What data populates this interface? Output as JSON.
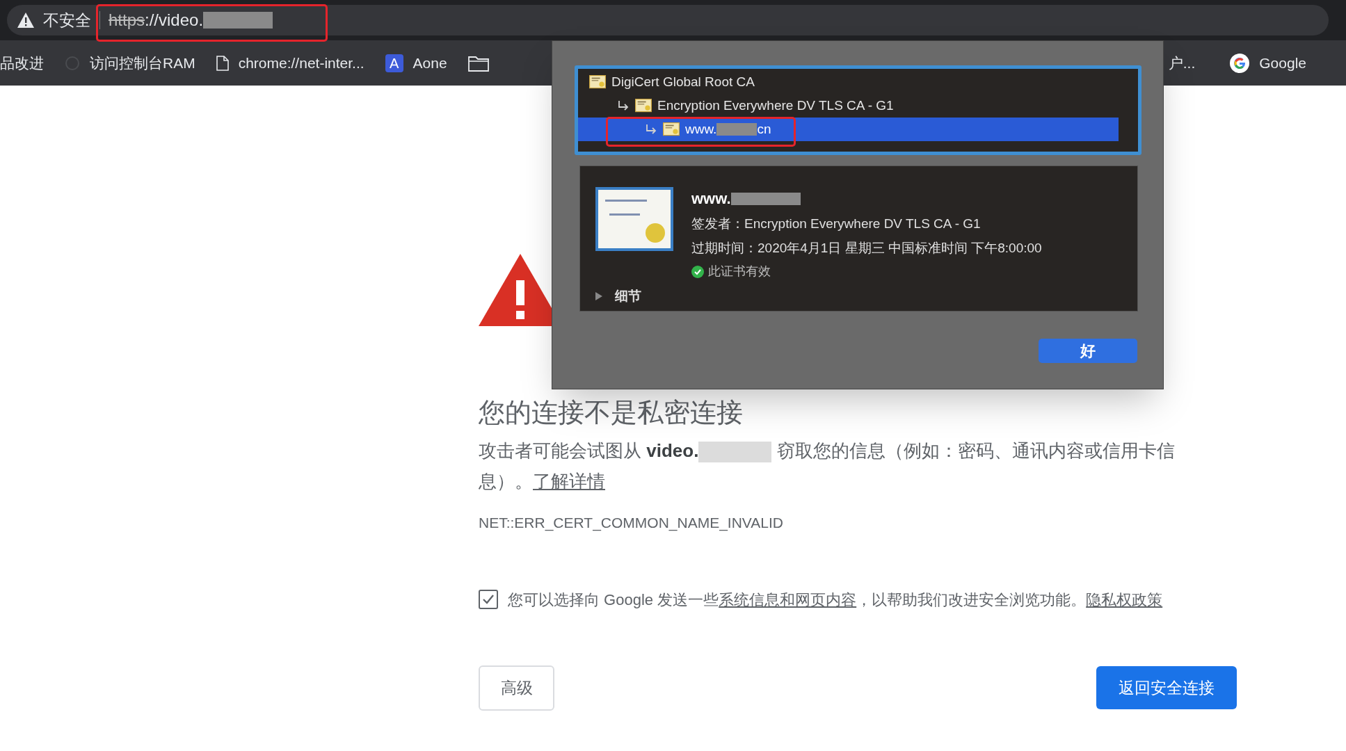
{
  "address_bar": {
    "security_label": "不安全",
    "url_scheme": "https",
    "url_rest": "://video."
  },
  "bookmarks": [
    {
      "kind": "text",
      "label": "品改进"
    },
    {
      "kind": "faint",
      "label": "访问控制台RAM"
    },
    {
      "kind": "page",
      "label": "chrome://net-inter..."
    },
    {
      "kind": "letter",
      "icon_letter": "A",
      "label": "Aone"
    },
    {
      "kind": "folder"
    }
  ],
  "bookmarks_right": [
    {
      "kind": "text",
      "label": "户..."
    },
    {
      "kind": "google",
      "label": "Google"
    }
  ],
  "certificate_dialog": {
    "tree": [
      {
        "name": "DigiCert Global Root CA",
        "selected": false,
        "children": [
          {
            "name": "Encryption Everywhere DV TLS CA - G1",
            "selected": false,
            "children": [
              {
                "name": "www.",
                "after_redaction": "cn",
                "selected": true
              }
            ]
          }
        ]
      }
    ],
    "details": {
      "title": "www.",
      "issuer_label": "签发者：",
      "issuer": "Encryption Everywhere DV TLS CA - G1",
      "expiry_label": "过期时间：",
      "expiry": "2020年4月1日 星期三 中国标准时间 下午8:00:00",
      "valid": true,
      "status": "此证书有效",
      "toggle_label": "细节",
      "expanded": false
    },
    "ok_button": "好"
  },
  "page": {
    "title": "您的连接不是私密连接",
    "warning_before": "攻击者可能会试图从 ",
    "warning_host": "video.",
    "warning_after": " 窃取您的信息（例如：密码、通讯内容或信用卡信息）。",
    "learn_more": "了解详情",
    "error_code": "NET::ERR_CERT_COMMON_NAME_INVALID",
    "consent": {
      "checked": true,
      "before": "您可以选择向 Google 发送一些",
      "link": "系统信息和网页内容",
      "middle": "，以帮助我们改进安全浏览功能。",
      "policy_link": "隐私权政策"
    },
    "advanced_button": "高级",
    "back_button": "返回安全连接"
  }
}
